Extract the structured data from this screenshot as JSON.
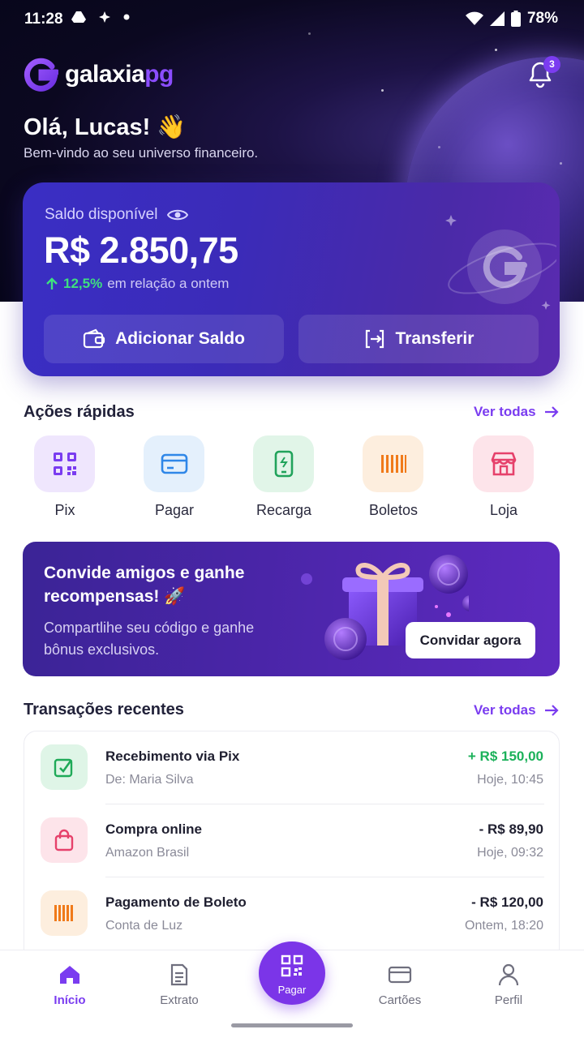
{
  "status_bar": {
    "time": "11:28",
    "battery": "78%"
  },
  "brand": {
    "name_main": "galaxia",
    "name_accent": "pg",
    "accent_color": "#7a3cf0"
  },
  "notifications": {
    "badge_count": "3"
  },
  "greeting": {
    "title": "Olá, Lucas! 👋",
    "subtitle": "Bem-vindo ao seu universo financeiro."
  },
  "balance": {
    "label": "Saldo disponível",
    "amount": "R$ 2.850,75",
    "change_value": "12,5%",
    "change_text": "em relação a ontem",
    "add_label": "Adicionar Saldo",
    "transfer_label": "Transferir"
  },
  "quick_actions": {
    "title": "Ações rápidas",
    "see_all": "Ver todas",
    "items": [
      {
        "label": "Pix",
        "icon": "pix-qr-icon",
        "color": "#7a3cf0",
        "bg": "#efe6fd"
      },
      {
        "label": "Pagar",
        "icon": "card-icon",
        "color": "#2f87e8",
        "bg": "#e4f0fc"
      },
      {
        "label": "Recarga",
        "icon": "phone-icon",
        "color": "#21a35b",
        "bg": "#e1f5e8"
      },
      {
        "label": "Boletos",
        "icon": "barcode-icon",
        "color": "#f07a1a",
        "bg": "#fdeede"
      },
      {
        "label": "Loja",
        "icon": "store-icon",
        "color": "#e6416b",
        "bg": "#fde4ea"
      }
    ]
  },
  "invite": {
    "title": "Convide amigos e ganhe recompensas! 🚀",
    "subtitle": "Compartlihe seu código e ganhe bônus exclusivos.",
    "button": "Convidar agora"
  },
  "transactions": {
    "title": "Transações recentes",
    "see_all": "Ver todas",
    "items": [
      {
        "title": "Recebimento via Pix",
        "sub": "De: Maria Silva",
        "amount": "+ R$ 150,00",
        "date": "Hoje, 10:45",
        "type": "credit",
        "icon": "pix-received-icon"
      },
      {
        "title": "Compra online",
        "sub": "Amazon Brasil",
        "amount": "- R$ 89,90",
        "date": "Hoje, 09:32",
        "type": "debit",
        "icon": "shopping-bag-icon"
      },
      {
        "title": "Pagamento de Boleto",
        "sub": "Conta de Luz",
        "amount": "- R$ 120,00",
        "date": "Ontem, 18:20",
        "type": "debit",
        "icon": "barcode-icon"
      }
    ]
  },
  "bottom_nav": {
    "items": [
      {
        "label": "Início",
        "icon": "home-icon",
        "active": true
      },
      {
        "label": "Extrato",
        "icon": "statement-icon",
        "active": false
      },
      {
        "label": "Pagar",
        "icon": "qr-icon",
        "active": false
      },
      {
        "label": "Cartões",
        "icon": "cards-icon",
        "active": false
      },
      {
        "label": "Perfil",
        "icon": "profile-icon",
        "active": false
      }
    ]
  }
}
